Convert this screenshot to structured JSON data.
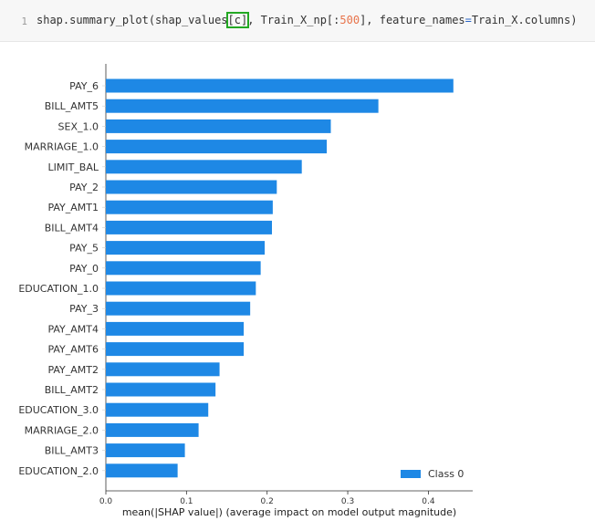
{
  "cell": {
    "line_number": "1",
    "code_part1": "shap.summary_plot(shap_values",
    "code_bracket_open": "[",
    "code_index": "c",
    "code_bracket_close": "]",
    "code_part2": ", Train_X_np[:",
    "code_number": "500",
    "code_part3": "], feature_names",
    "code_equals": "=",
    "code_part4": "Train_X.columns)"
  },
  "colors": {
    "bar": "#1e88e5",
    "code_background": "#f7f7f7",
    "number_literal": "#e8734a",
    "operator": "#2b66c7",
    "bracket_highlight": "#23a823"
  },
  "chart_data": {
    "type": "bar",
    "orientation": "horizontal",
    "categories": [
      "PAY_6",
      "BILL_AMT5",
      "SEX_1.0",
      "MARRIAGE_1.0",
      "LIMIT_BAL",
      "PAY_2",
      "PAY_AMT1",
      "BILL_AMT4",
      "PAY_5",
      "PAY_0",
      "EDUCATION_1.0",
      "PAY_3",
      "PAY_AMT4",
      "PAY_AMT6",
      "PAY_AMT2",
      "BILL_AMT2",
      "EDUCATION_3.0",
      "MARRIAGE_2.0",
      "BILL_AMT3",
      "EDUCATION_2.0"
    ],
    "series": [
      {
        "name": "Class 0",
        "values": [
          0.431,
          0.338,
          0.279,
          0.274,
          0.243,
          0.212,
          0.207,
          0.206,
          0.197,
          0.192,
          0.186,
          0.179,
          0.171,
          0.171,
          0.141,
          0.136,
          0.127,
          0.115,
          0.098,
          0.089
        ]
      }
    ],
    "xlabel": "mean(|SHAP value|) (average impact on model output magnitude)",
    "xlim": [
      0,
      0.455
    ],
    "xticks": [
      0.0,
      0.1,
      0.2,
      0.3,
      0.4
    ],
    "xtick_labels": [
      "0.0",
      "0.1",
      "0.2",
      "0.3",
      "0.4"
    ],
    "legend_placement": "lower-right",
    "grid": false
  }
}
